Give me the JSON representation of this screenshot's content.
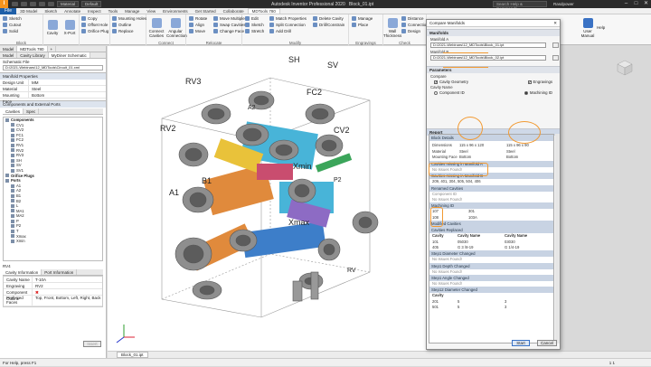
{
  "titlebar": {
    "logo": "I",
    "material_combo": "Material",
    "appearance_combo": "Default",
    "title": "Autodesk Inventor Professional 2020",
    "file": "Block_01.ipt",
    "search_placeholder": "Search Help & Commands...",
    "user": "Rasdpower",
    "minimize": "–",
    "maximize": "□",
    "close": "✕"
  },
  "tabs": [
    "File",
    "3D Model",
    "Sketch",
    "Annotate",
    "Inspect",
    "Tools",
    "Manage",
    "View",
    "Environments",
    "Get Started",
    "Collaborate",
    "MDTools 780"
  ],
  "active_tab": "MDTools 780",
  "ribbon": {
    "block_group": {
      "label": "Block",
      "items": [
        "Sketch",
        "Cutout",
        "Solid",
        "Block"
      ]
    },
    "cavity_group": {
      "items": [
        "Cavity",
        "X-Port"
      ],
      "small": [
        "Copy",
        "Offset Hole",
        "Orifice Plug"
      ]
    },
    "holes_group": {
      "items": [
        "Mounting Holes",
        "Outline",
        "Replace"
      ]
    },
    "connect_group": {
      "label": "Connect",
      "items": [
        "Connect Cavities",
        "Angular Connection"
      ]
    },
    "relocate_group": {
      "label": "Relocate",
      "items": [
        "Rotate",
        "Align",
        "Move",
        "Move Multiple",
        "Swap Cavities",
        "Change Face"
      ]
    },
    "modify_group": {
      "label": "Modify",
      "items": [
        "Edit",
        "Sketch",
        "Stretch",
        "Match Properties",
        "Split Connection",
        "Add Drill",
        "Delete Cavity",
        "Drill/Constrain"
      ]
    },
    "engravings_group": {
      "label": "Engravings",
      "items": [
        "Manage",
        "Place"
      ]
    },
    "check_group": {
      "label": "Check",
      "items": [
        "Wall Thickness",
        "Distance",
        "Connection",
        "Design"
      ]
    },
    "help_group": {
      "items": [
        "User Manual",
        "Help"
      ]
    }
  },
  "left_panel": {
    "tabs": [
      "Model",
      "MDTools 780",
      "+"
    ],
    "subtabs": [
      "Model",
      "Cavity Library",
      "MyDiner Schematic"
    ],
    "schematic_file_label": "Schematic File",
    "schematic_file_value": "D:\\2021-Webinars\\12_MDTools\\Circuit_01.xml",
    "manifold_props_title": "Manifold Properties",
    "props": [
      {
        "k": "Design Unit",
        "v": "MM"
      },
      {
        "k": "Material",
        "v": "Steel"
      },
      {
        "k": "Mounting Face",
        "v": "Bottom"
      }
    ],
    "components_title": "Components and External Ports",
    "components_tabs": [
      "Cavities",
      "Spec"
    ],
    "tree": [
      {
        "label": "Components",
        "level": 0,
        "bold": true
      },
      {
        "label": "CV1",
        "level": 1
      },
      {
        "label": "CV2",
        "level": 1
      },
      {
        "label": "FC1",
        "level": 1
      },
      {
        "label": "FC2",
        "level": 1
      },
      {
        "label": "RV1",
        "level": 1
      },
      {
        "label": "RV2",
        "level": 1
      },
      {
        "label": "RV3",
        "level": 1
      },
      {
        "label": "SH",
        "level": 1
      },
      {
        "label": "SV",
        "level": 1
      },
      {
        "label": "SV1",
        "level": 1
      },
      {
        "label": "Orifice Plugs",
        "level": 0,
        "bold": true
      },
      {
        "label": "Ports",
        "level": 0,
        "bold": true
      },
      {
        "label": "A1",
        "level": 1
      },
      {
        "label": "A2",
        "level": 1
      },
      {
        "label": "B1",
        "level": 1
      },
      {
        "label": "B2",
        "level": 1
      },
      {
        "label": "L",
        "level": 1
      },
      {
        "label": "MA1",
        "level": 1
      },
      {
        "label": "MA2",
        "level": 1
      },
      {
        "label": "P",
        "level": 1
      },
      {
        "label": "P2",
        "level": 1
      },
      {
        "label": "T",
        "level": 1
      },
      {
        "label": "Xmax",
        "level": 1
      },
      {
        "label": "Xmin",
        "level": 1
      }
    ],
    "selected_item": "RV4",
    "info_tabs": [
      "Cavity Information",
      "Port Information"
    ],
    "info": [
      {
        "k": "Cavity Name",
        "v": "T-10A"
      },
      {
        "k": "Engraving",
        "v": "RV2"
      },
      {
        "k": "Component Outline",
        "v": "✖"
      },
      {
        "k": "Preferred Faces",
        "v": "Top, Front, Bottom, Left, Right, Back"
      }
    ],
    "insert_button": "Insert"
  },
  "viewport": {
    "labels": [
      "SH",
      "SV",
      "RV3",
      "RV2",
      "FC2",
      "CV2",
      "A1",
      "B1",
      "Xmin",
      "Xmax",
      "RV",
      "P2",
      "A2"
    ]
  },
  "doc_tab": "Block_01.ipt",
  "status": {
    "left": "For Help, press F1",
    "right": "1  1"
  },
  "dialog": {
    "title": "Compare Manifolds",
    "close": "✕",
    "manifolds_label": "Manifolds",
    "manifold_a_label": "Manifold A",
    "manifold_a_value": "D:\\2021-Webinars\\12_MDTools\\Block_01.ipt",
    "manifold_b_label": "Manifold B",
    "manifold_b_value": "D:\\2021-Webinars\\12_MDTools\\Block_02.ipt",
    "parameters_label": "Parameters",
    "compare_label": "Compare",
    "cavity_geometry": "Cavity Geometry",
    "engravings": "Engravings",
    "cavity_name_label": "Cavity Name",
    "component_id": "Component ID",
    "machining_id": "Machining ID",
    "report_label": "Report",
    "block_details": "Block Details",
    "dimensions_label": "Dimensions",
    "dim_a": "115 x 96 x 120",
    "dim_b": "115 x 96 x 90",
    "material_label": "Material",
    "material_a": "Steel",
    "material_b": "Steel",
    "mounting_label": "Mounting Face",
    "mounting_a": "Bottom",
    "mounting_b": "Bottom",
    "missing_a_title": "Cavities missing in Manifold A",
    "no_issues_1": "No Issues Found!",
    "missing_b_title": "Cavities missing in Manifold B",
    "missing_b_value": "209, 401, 304, 505, 504, 406",
    "renamed_title": "Renamed Cavities",
    "component_id_sub": "Component ID",
    "no_issues_2": "No Issues Found!",
    "machining_id_sub": "Machining ID",
    "renamed_rows": [
      {
        "a": "107",
        "b": "301"
      },
      {
        "a": "108",
        "b": "103A"
      }
    ],
    "modified_title": "Modified Cavities",
    "replaced_title": "Cavities Replaced",
    "replaced_headers": [
      "Cavity",
      "Cavity Name",
      "Cavity Name"
    ],
    "replaced_rows": [
      {
        "c": "101",
        "a": "05030",
        "b": "03030"
      },
      {
        "c": "405",
        "a": "G 3 /8-19",
        "b": "G 1/4-19"
      }
    ],
    "step1_title": "Step1 Diameter Changed",
    "no_issues_3": "No Issues Found!",
    "step1_depth_title": "Step1 Depth Changed",
    "no_issues_4": "No Issues Found!",
    "step1_angle_title": "Step1 Angle Changed",
    "no_issues_5": "No Issues Found!",
    "step2_title": "Step12 Diameter Changed",
    "step2_header": "Cavity",
    "step2_rows": [
      {
        "c": "201",
        "a": "5",
        "b": "3"
      },
      {
        "c": "501",
        "a": "5",
        "b": "3"
      }
    ],
    "start_button": "Start",
    "cancel_button": "Cancel"
  }
}
